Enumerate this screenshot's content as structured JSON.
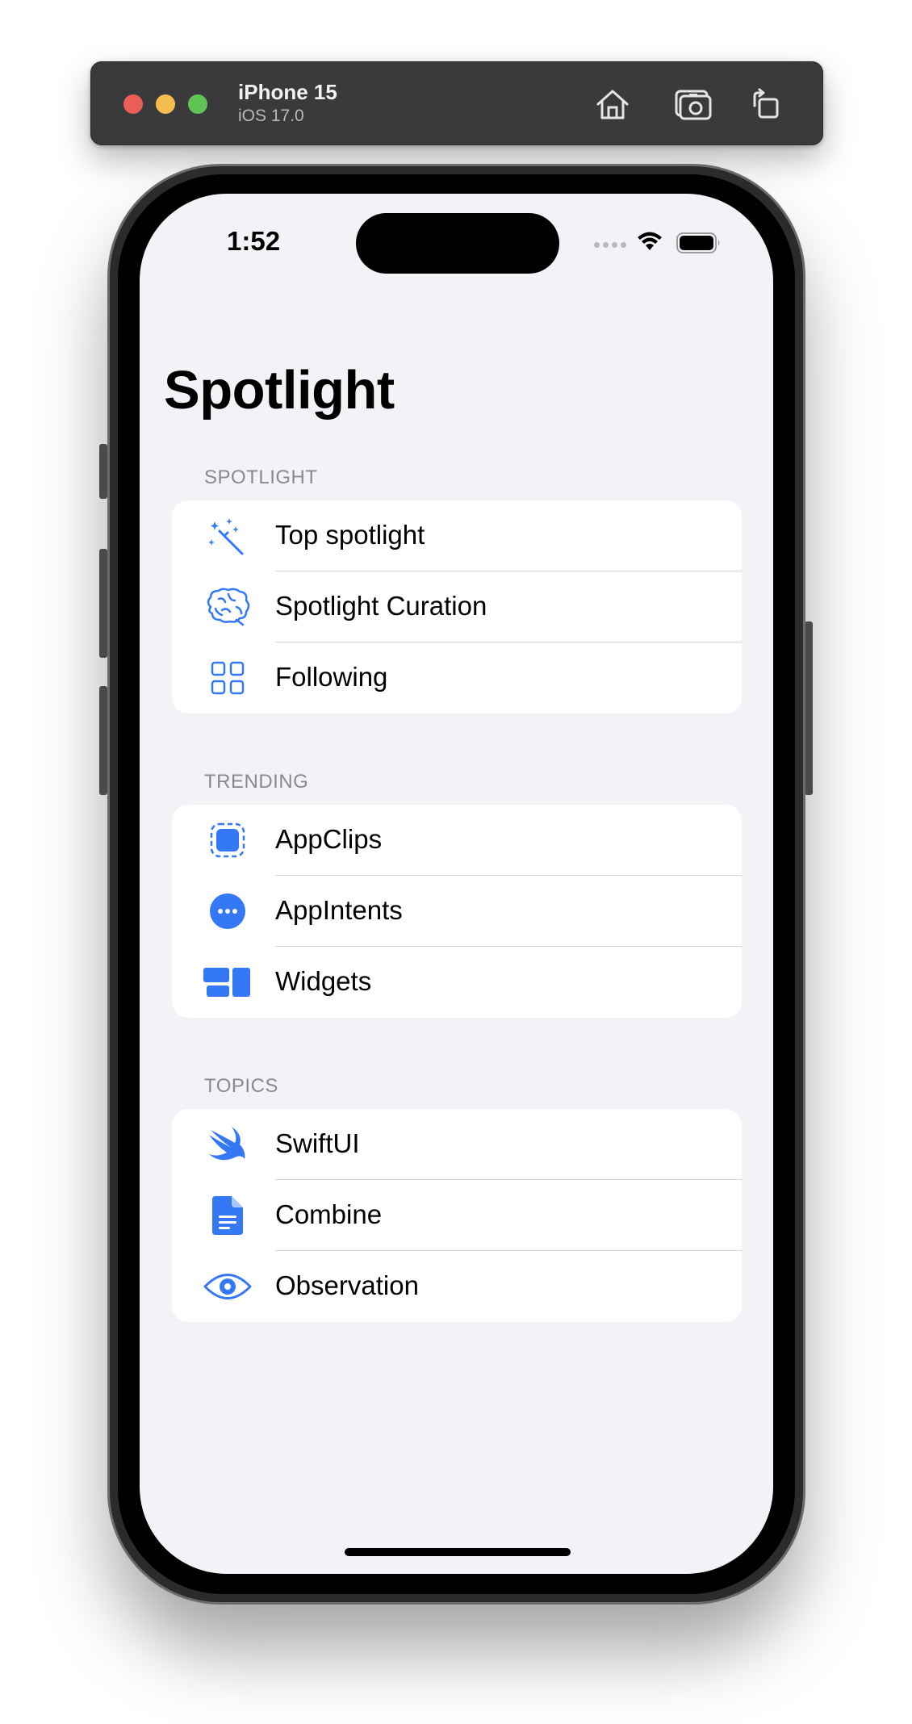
{
  "simulator": {
    "device_name": "iPhone 15",
    "os_version": "iOS 17.0",
    "toolbar_icons": [
      "home-icon",
      "screenshot-icon",
      "rotate-icon"
    ]
  },
  "status_bar": {
    "time": "1:52",
    "icons": [
      "signal-icon",
      "wifi-icon",
      "battery-icon"
    ]
  },
  "accent_color": "#3478f6",
  "screen": {
    "title": "Spotlight",
    "sections": [
      {
        "header": "SPOTLIGHT",
        "items": [
          {
            "label": "Top spotlight",
            "icon": "magic-wand-icon"
          },
          {
            "label": "Spotlight Curation",
            "icon": "brain-icon"
          },
          {
            "label": "Following",
            "icon": "grid-icon"
          }
        ]
      },
      {
        "header": "TRENDING",
        "items": [
          {
            "label": "AppClips",
            "icon": "appclip-icon"
          },
          {
            "label": "AppIntents",
            "icon": "ellipsis-circle-icon"
          },
          {
            "label": "Widgets",
            "icon": "widgets-icon"
          }
        ]
      },
      {
        "header": "TOPICS",
        "items": [
          {
            "label": "SwiftUI",
            "icon": "swift-icon"
          },
          {
            "label": "Combine",
            "icon": "document-icon"
          },
          {
            "label": "Observation",
            "icon": "eye-icon"
          }
        ]
      }
    ]
  }
}
